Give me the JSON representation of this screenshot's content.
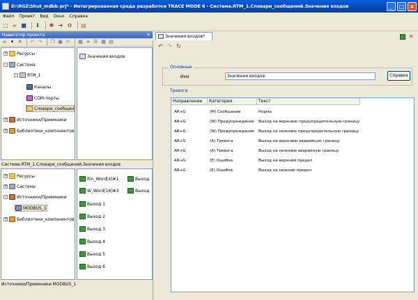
{
  "window": {
    "title": "D:\\RGZ\\Shut_mdbb.prj* - Интегрированная среда разработки TRACE MODE 6 - Система.RTM_1.Словари_сообщений.Значения входов"
  },
  "menu": [
    "Файл",
    "Проект",
    "Вид",
    "Окно",
    "Справка"
  ],
  "navigator": {
    "title": "Навигатор проекта",
    "tree": [
      {
        "label": "Ресурсы",
        "icon": "folder-icon",
        "expander": "+"
      },
      {
        "label": "Система",
        "icon": "system-icon",
        "expander": "-"
      },
      {
        "label": "RTM_1",
        "icon": "rtm-icon",
        "expander": "-"
      },
      {
        "label": "Каналы",
        "icon": "channels-icon",
        "expander": ""
      },
      {
        "label": "COM-порты",
        "icon": "com-port-icon",
        "expander": ""
      },
      {
        "label": "Словари_сообщен",
        "icon": "dictionary-icon",
        "expander": ""
      },
      {
        "label": "Источники/Приемники",
        "icon": "io-icon",
        "expander": "+"
      },
      {
        "label": "Библиотеки_компонентов",
        "icon": "library-icon",
        "expander": "+"
      }
    ],
    "content_item": "Значения входов",
    "path": "Система.RTM_1.Словари_сообщений.Значения входов"
  },
  "lower_tree": [
    {
      "label": "Ресурсы",
      "icon": "folder-icon",
      "expander": "+"
    },
    {
      "label": "Система",
      "icon": "system-icon",
      "expander": "+"
    },
    {
      "label": "Источники/Приемники",
      "icon": "io-icon",
      "expander": "-"
    },
    {
      "label": "MODBUS_1",
      "icon": "modbus-icon",
      "expander": ""
    },
    {
      "label": "Библиотеки_компонентов",
      "icon": "library-icon",
      "expander": "+"
    }
  ],
  "lower_items": [
    "Rin_Word[4]#1",
    "Выход",
    "W_Word[16]#3",
    "Выход",
    "Выход 1",
    "Выход 2",
    "Выход 3",
    "Выход 4",
    "Выход 5",
    "Выход 6"
  ],
  "status_path": "Источники/Приемники.MODBUS_1",
  "editor": {
    "tab_label": "Значения входов*",
    "main_group": "Основные",
    "name_label": "Имя",
    "name_value": "Значения входов",
    "help_button": "Справка",
    "alarms_group": "Тревоги",
    "columns": [
      "Направление",
      "Категория",
      "Текст"
    ],
    "rows": [
      [
        "AR+G",
        "(M) Сообщение",
        "Норма"
      ],
      [
        "AR+G",
        "(W) Предупреждение",
        "Выход на верхнюю предупредительную границу"
      ],
      [
        "AR+G",
        "(W) Предупреждение",
        "Выход на нижнюю предупредительную границу"
      ],
      [
        "AR+G",
        "(A) Тревога",
        "Выход на верхнюю аварийную границу"
      ],
      [
        "AR+G",
        "(A) Тревога",
        "Выход на нижнюю аварийную границу"
      ],
      [
        "AR+G",
        "(E) Ошибка",
        "Выход на верхний предел"
      ],
      [
        "AR+G",
        "(E) Ошибка",
        "Выход на нижний предел"
      ]
    ]
  }
}
